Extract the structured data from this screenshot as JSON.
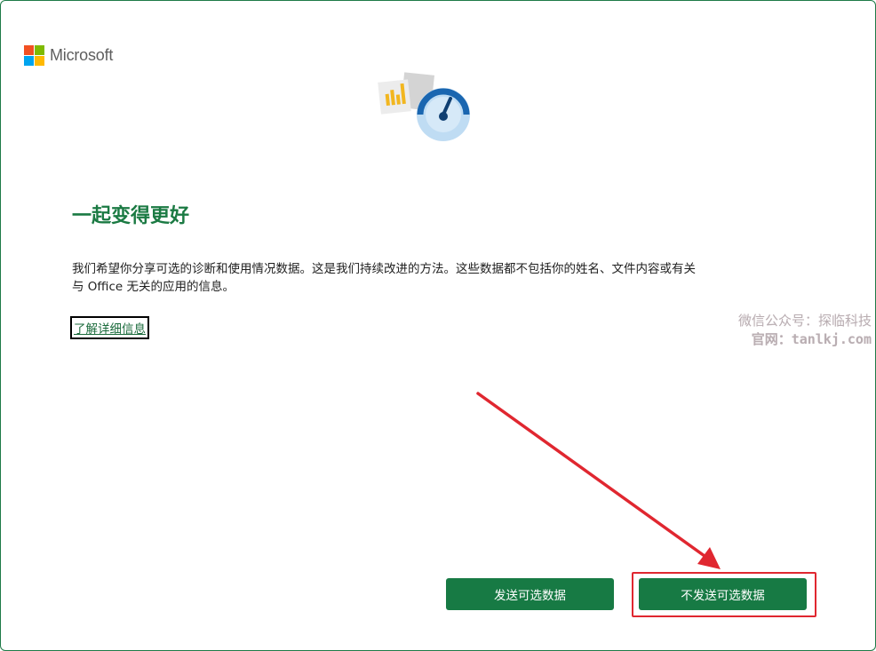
{
  "brand": {
    "name": "Microsoft",
    "logo_colors": [
      "#f25022",
      "#7fba00",
      "#00a4ef",
      "#ffb900"
    ]
  },
  "illustration": {
    "icons": [
      "bar-chart-document-icon",
      "speedometer-gauge-icon"
    ],
    "colors": {
      "gauge_blue": "#1a66b0",
      "gauge_light": "#bfdcf3",
      "chart_yellow": "#f2b61f",
      "doc_gray": "#d9d9d9"
    }
  },
  "content": {
    "title": "一起变得更好",
    "description_line1": "我们希望你分享可选的诊断和使用情况数据。这是我们持续改进的方法。这些数据都不包括你的姓名、文件内容或有关",
    "description_line2": "与 Office 无关的应用的信息。",
    "learn_more": "了解详细信息"
  },
  "watermark": {
    "line1": "微信公众号：探临科技",
    "line2": "官网：tanlkj.com"
  },
  "buttons": {
    "send_optional": "发送可选数据",
    "dont_send_optional": "不发送可选数据"
  },
  "colors": {
    "accent_green": "#177a44",
    "title_green": "#1b7a43",
    "annotation_red": "#e02730"
  }
}
